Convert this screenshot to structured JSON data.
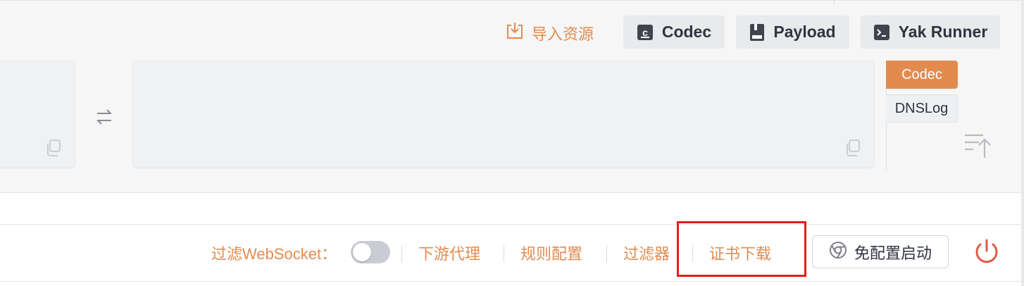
{
  "toolbar": {
    "import_label": "导入资源",
    "codec_label": "Codec",
    "payload_label": "Payload",
    "yak_runner_label": "Yak Runner"
  },
  "side_tabs": [
    {
      "label": "Codec",
      "active": true
    },
    {
      "label": "DNSLog",
      "active": false
    }
  ],
  "bottom_bar": {
    "filter_websocket_label": "过滤WebSocket：",
    "filter_websocket_enabled": false,
    "downstream_proxy": "下游代理",
    "rule_config": "规则配置",
    "filter": "过滤器",
    "cert_download": "证书下载",
    "launch_button": "免配置启动"
  },
  "colors": {
    "accent": "#e38b4f",
    "highlight": "#e51d1d",
    "power": "#e05a47",
    "button_bg": "#e9eaec",
    "text_dark": "#31343f"
  },
  "icons": [
    "import-icon",
    "codec-icon",
    "payload-icon",
    "terminal-icon",
    "swap-icon",
    "copy-icon",
    "sort-icon",
    "chrome-icon",
    "power-icon"
  ]
}
